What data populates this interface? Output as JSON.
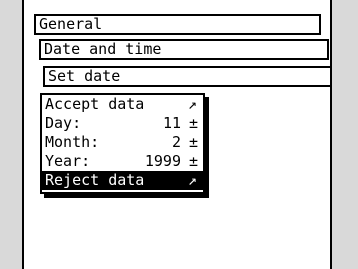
{
  "menu": {
    "level1": "General",
    "level2": "Date and time",
    "level3": "Set date"
  },
  "submenu": {
    "accept_label": "Accept data",
    "accept_arrow": "↗",
    "day_label": "Day:",
    "day_value": "11",
    "month_label": "Month:",
    "month_value": "2",
    "year_label": "Year:",
    "year_value": "1999",
    "adjust_symbol": "±",
    "reject_label": "Reject data",
    "reject_arrow": "↗"
  },
  "colors": {
    "background": "#d9d9d9",
    "screen": "#ffffff",
    "ink": "#000000"
  }
}
